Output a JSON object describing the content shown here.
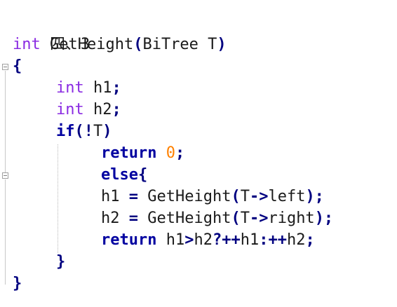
{
  "code_lines": [
    {
      "text": "四、3"
    },
    {
      "tokens": [
        "int",
        " GetHeight",
        "(",
        "BiTree T",
        ")"
      ]
    },
    {
      "tokens": [
        "{"
      ]
    },
    {
      "tokens": [
        "int",
        " h1",
        ";"
      ]
    },
    {
      "tokens": [
        "int",
        " h2",
        ";"
      ]
    },
    {
      "tokens": [
        "if",
        "(!",
        "T",
        ")"
      ]
    },
    {
      "tokens": [
        "return",
        " ",
        "0",
        ";"
      ]
    },
    {
      "tokens": [
        "else",
        "{"
      ]
    },
    {
      "tokens": [
        "h1 ",
        "=",
        " GetHeight",
        "(",
        "T",
        "->",
        "left",
        ");"
      ]
    },
    {
      "tokens": [
        "h2 ",
        "=",
        " GetHeight",
        "(",
        "T",
        "->",
        "right",
        ");"
      ]
    },
    {
      "tokens": [
        "return",
        " h1",
        ">",
        "h2",
        "?++",
        "h1",
        ":++",
        "h2",
        ";"
      ]
    },
    {
      "tokens": [
        "}"
      ]
    },
    {
      "tokens": [
        "}"
      ]
    }
  ]
}
